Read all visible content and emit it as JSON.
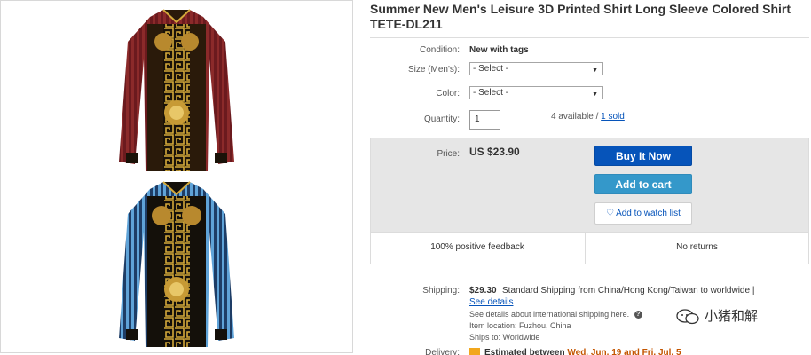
{
  "listing": {
    "title": "Summer New Men's Leisure 3D Printed Shirt Long Sleeve Colored Shirt TETE-DL211"
  },
  "condition": {
    "label": "Condition:",
    "value": "New with tags"
  },
  "size": {
    "label": "Size (Men's):",
    "selected": "- Select -"
  },
  "color": {
    "label": "Color:",
    "selected": "- Select -"
  },
  "quantity": {
    "label": "Quantity:",
    "value": "1",
    "available": "4 available /",
    "sold": "1 sold"
  },
  "price": {
    "label": "Price:",
    "value": "US $23.90"
  },
  "buttons": {
    "buy_now": "Buy It Now",
    "add_to_cart": "Add to cart",
    "watch": "Add to watch list"
  },
  "feedback": {
    "positive": "100% positive feedback",
    "returns": "No returns"
  },
  "shipping": {
    "label": "Shipping:",
    "price": "$29.30",
    "method": "Standard Shipping from China/Hong Kong/Taiwan to worldwide |",
    "see_details": "See details",
    "intl_note": "See details about international shipping here.",
    "location": "Item location:  Fuzhou, China",
    "ships_to": "Ships to:  Worldwide"
  },
  "delivery": {
    "label": "Delivery:",
    "text": "Estimated between",
    "dates": "Wed. Jun. 19 and Fri. Jul. 5"
  },
  "watermark": {
    "text": "小猪和解"
  },
  "colors": {
    "link": "#0654ba",
    "buy": "#0654ba",
    "cart": "#3498ca",
    "box": "#e6e6e6"
  },
  "icons": {
    "help": "help-icon",
    "heart": "heart-icon",
    "dropdown": "chevron-down-icon",
    "wechat": "wechat-icon"
  }
}
